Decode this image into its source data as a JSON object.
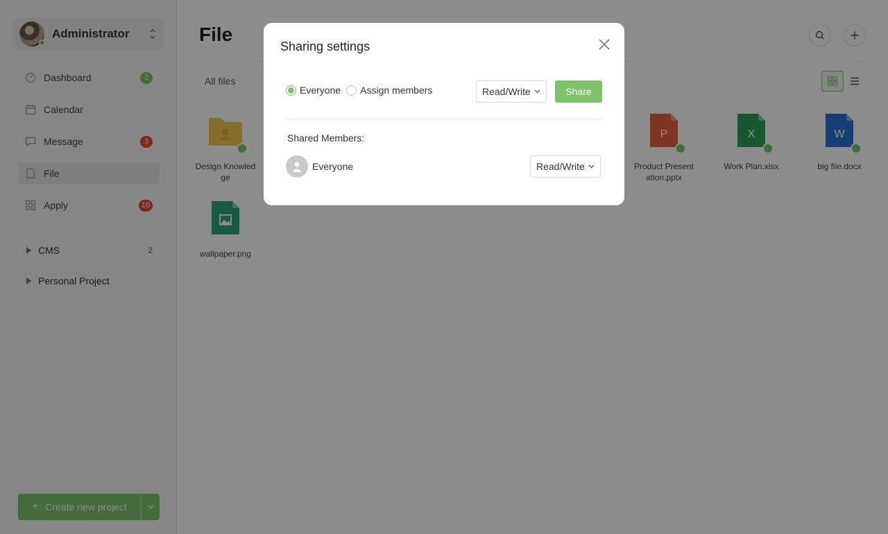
{
  "sidebar": {
    "user": {
      "name": "Administrator"
    },
    "nav": [
      {
        "label": "Dashboard",
        "badge": "2",
        "badge_color": "#7cc36a"
      },
      {
        "label": "Calendar",
        "badge": ""
      },
      {
        "label": "Message",
        "badge": "3",
        "badge_color": "#e84a39"
      },
      {
        "label": "File",
        "badge": "",
        "active": true
      },
      {
        "label": "Apply",
        "badge": "10",
        "badge_color": "#e84a39"
      }
    ],
    "projects": [
      {
        "label": "CMS",
        "count": "2"
      },
      {
        "label": "Personal Project",
        "count": ""
      }
    ],
    "create_button": {
      "label": "Create new project"
    }
  },
  "main": {
    "title": "File",
    "breadcrumb": "All files",
    "files": [
      {
        "name": "Design Knowled ge",
        "type": "folder",
        "letter": ""
      },
      {
        "name": "Product Present ation.pptx",
        "type": "pptx",
        "letter": "P"
      },
      {
        "name": "Work Plan.xlsx",
        "type": "xlsx",
        "letter": "X"
      },
      {
        "name": "big file.docx",
        "type": "docx",
        "letter": "W"
      },
      {
        "name": "wallpaper.png",
        "type": "png",
        "letter": ""
      }
    ]
  },
  "modal": {
    "title": "Sharing settings",
    "radio_everyone": "Everyone",
    "radio_assign": "Assign members",
    "permission": "Read/Write",
    "share_label": "Share",
    "shared_members_label": "Shared Members:",
    "members": [
      {
        "name": "Everyone",
        "permission": "Read/Write"
      }
    ]
  },
  "colors": {
    "accent": "#7cc36a",
    "badge_red": "#e84a39",
    "folder": "#f3c94f",
    "pptx": "#e8623f",
    "xlsx": "#2f9e5a",
    "docx": "#2b6fd6",
    "png": "#2fa178"
  }
}
